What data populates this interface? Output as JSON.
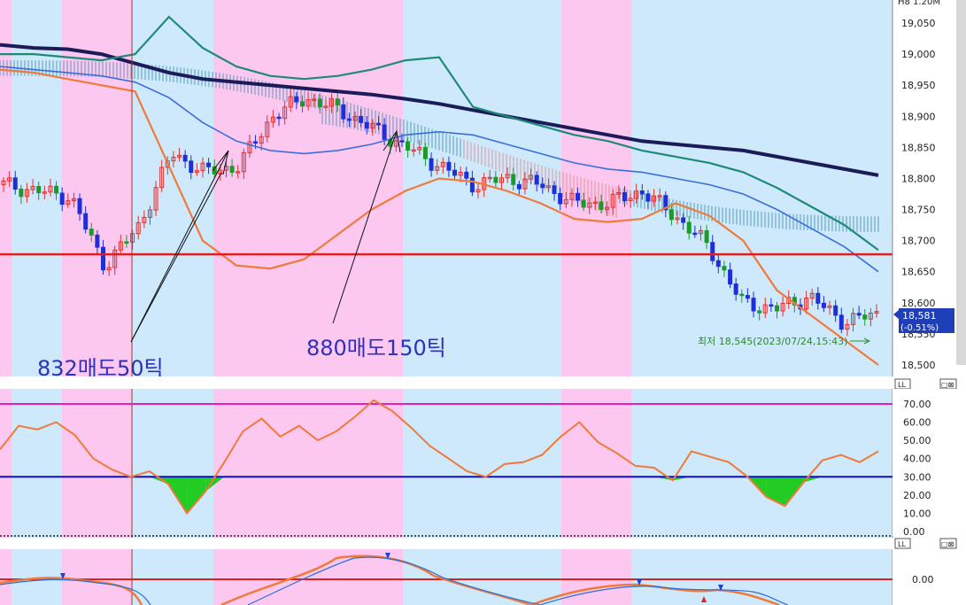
{
  "chart_data": [
    {
      "type": "candlestick",
      "title": "",
      "header_partial": "H8   1.20M",
      "y_ticks": [
        19050,
        19000,
        18950,
        18900,
        18850,
        18800,
        18750,
        18700,
        18650,
        18600,
        18550,
        18500
      ],
      "ylim": [
        18475,
        19080
      ],
      "ohlc_summary": {
        "open": 18800,
        "high": 18962,
        "low": 18545,
        "last": 18581,
        "shape": [
          18790,
          18780,
          18770,
          18660,
          18720,
          18840,
          18810,
          18820,
          18900,
          18930,
          18910,
          18880,
          18850,
          18820,
          18790,
          18800,
          18790,
          18760,
          18760,
          18780,
          18740,
          18690,
          18600,
          18590,
          18610,
          18570,
          18581
        ]
      },
      "moving_average_fast": [
        18975,
        18970,
        18960,
        18950,
        18940,
        18820,
        18700,
        18660,
        18655,
        18670,
        18710,
        18750,
        18780,
        18800,
        18795,
        18780,
        18760,
        18735,
        18730,
        18735,
        18760,
        18740,
        18700,
        18620,
        18580,
        18540,
        18500
      ],
      "moving_average_mid": [
        18980,
        18975,
        18970,
        18965,
        18955,
        18930,
        18890,
        18860,
        18845,
        18840,
        18845,
        18855,
        18870,
        18875,
        18870,
        18855,
        18840,
        18825,
        18815,
        18810,
        18800,
        18790,
        18775,
        18750,
        18720,
        18690,
        18650
      ],
      "moving_average_slow": [
        19015,
        19010,
        19008,
        19000,
        18985,
        18970,
        18960,
        18955,
        18950,
        18945,
        18940,
        18935,
        18928,
        18920,
        18910,
        18900,
        18890,
        18880,
        18870,
        18860,
        18855,
        18850,
        18845,
        18835,
        18825,
        18815,
        18805
      ],
      "horizontal_line": 18678,
      "current_price_label": "18,581",
      "current_change_label": "(-0.51%)",
      "low_label": "최저 18,545(2023/07/24,15:43)",
      "annotations": [
        {
          "text": "832매도50틱",
          "color": "#3030b8"
        },
        {
          "text": "880매도150틱",
          "color": "#3030b8"
        }
      ]
    },
    {
      "type": "line",
      "title": "",
      "y_ticks": [
        70.0,
        60.0,
        50.0,
        40.0,
        30.0,
        20.0,
        10.0,
        0.0
      ],
      "ylim": [
        0,
        80
      ],
      "reference_lines": [
        70,
        30
      ],
      "series": [
        {
          "values": [
            45,
            58,
            56,
            60,
            53,
            40,
            34,
            30,
            33,
            26,
            10,
            22,
            38,
            55,
            62,
            52,
            58,
            50,
            55,
            63,
            72,
            66,
            57,
            47,
            40,
            33,
            30,
            37,
            38,
            42,
            52,
            60,
            49,
            43,
            36,
            35,
            28,
            44,
            41,
            38,
            30,
            19,
            14,
            27,
            39,
            42,
            38,
            44
          ]
        }
      ]
    },
    {
      "type": "line",
      "title": "",
      "y_ticks": [
        0.0
      ],
      "reference_lines": [
        0
      ]
    }
  ],
  "tick_labels": {
    "main": [
      "19,050",
      "19,000",
      "18,950",
      "18,900",
      "18,850",
      "18,800",
      "18,750",
      "18,700",
      "18,650",
      "18,600",
      "18,550",
      "18,500"
    ],
    "rsi": [
      "70.00",
      "60.00",
      "50.00",
      "40.00",
      "30.00",
      "20.00",
      "10.00",
      "0.00"
    ],
    "macd": [
      "0.00"
    ]
  },
  "panel_buttons": {
    "left": "LL",
    "right": "▢⊠"
  }
}
